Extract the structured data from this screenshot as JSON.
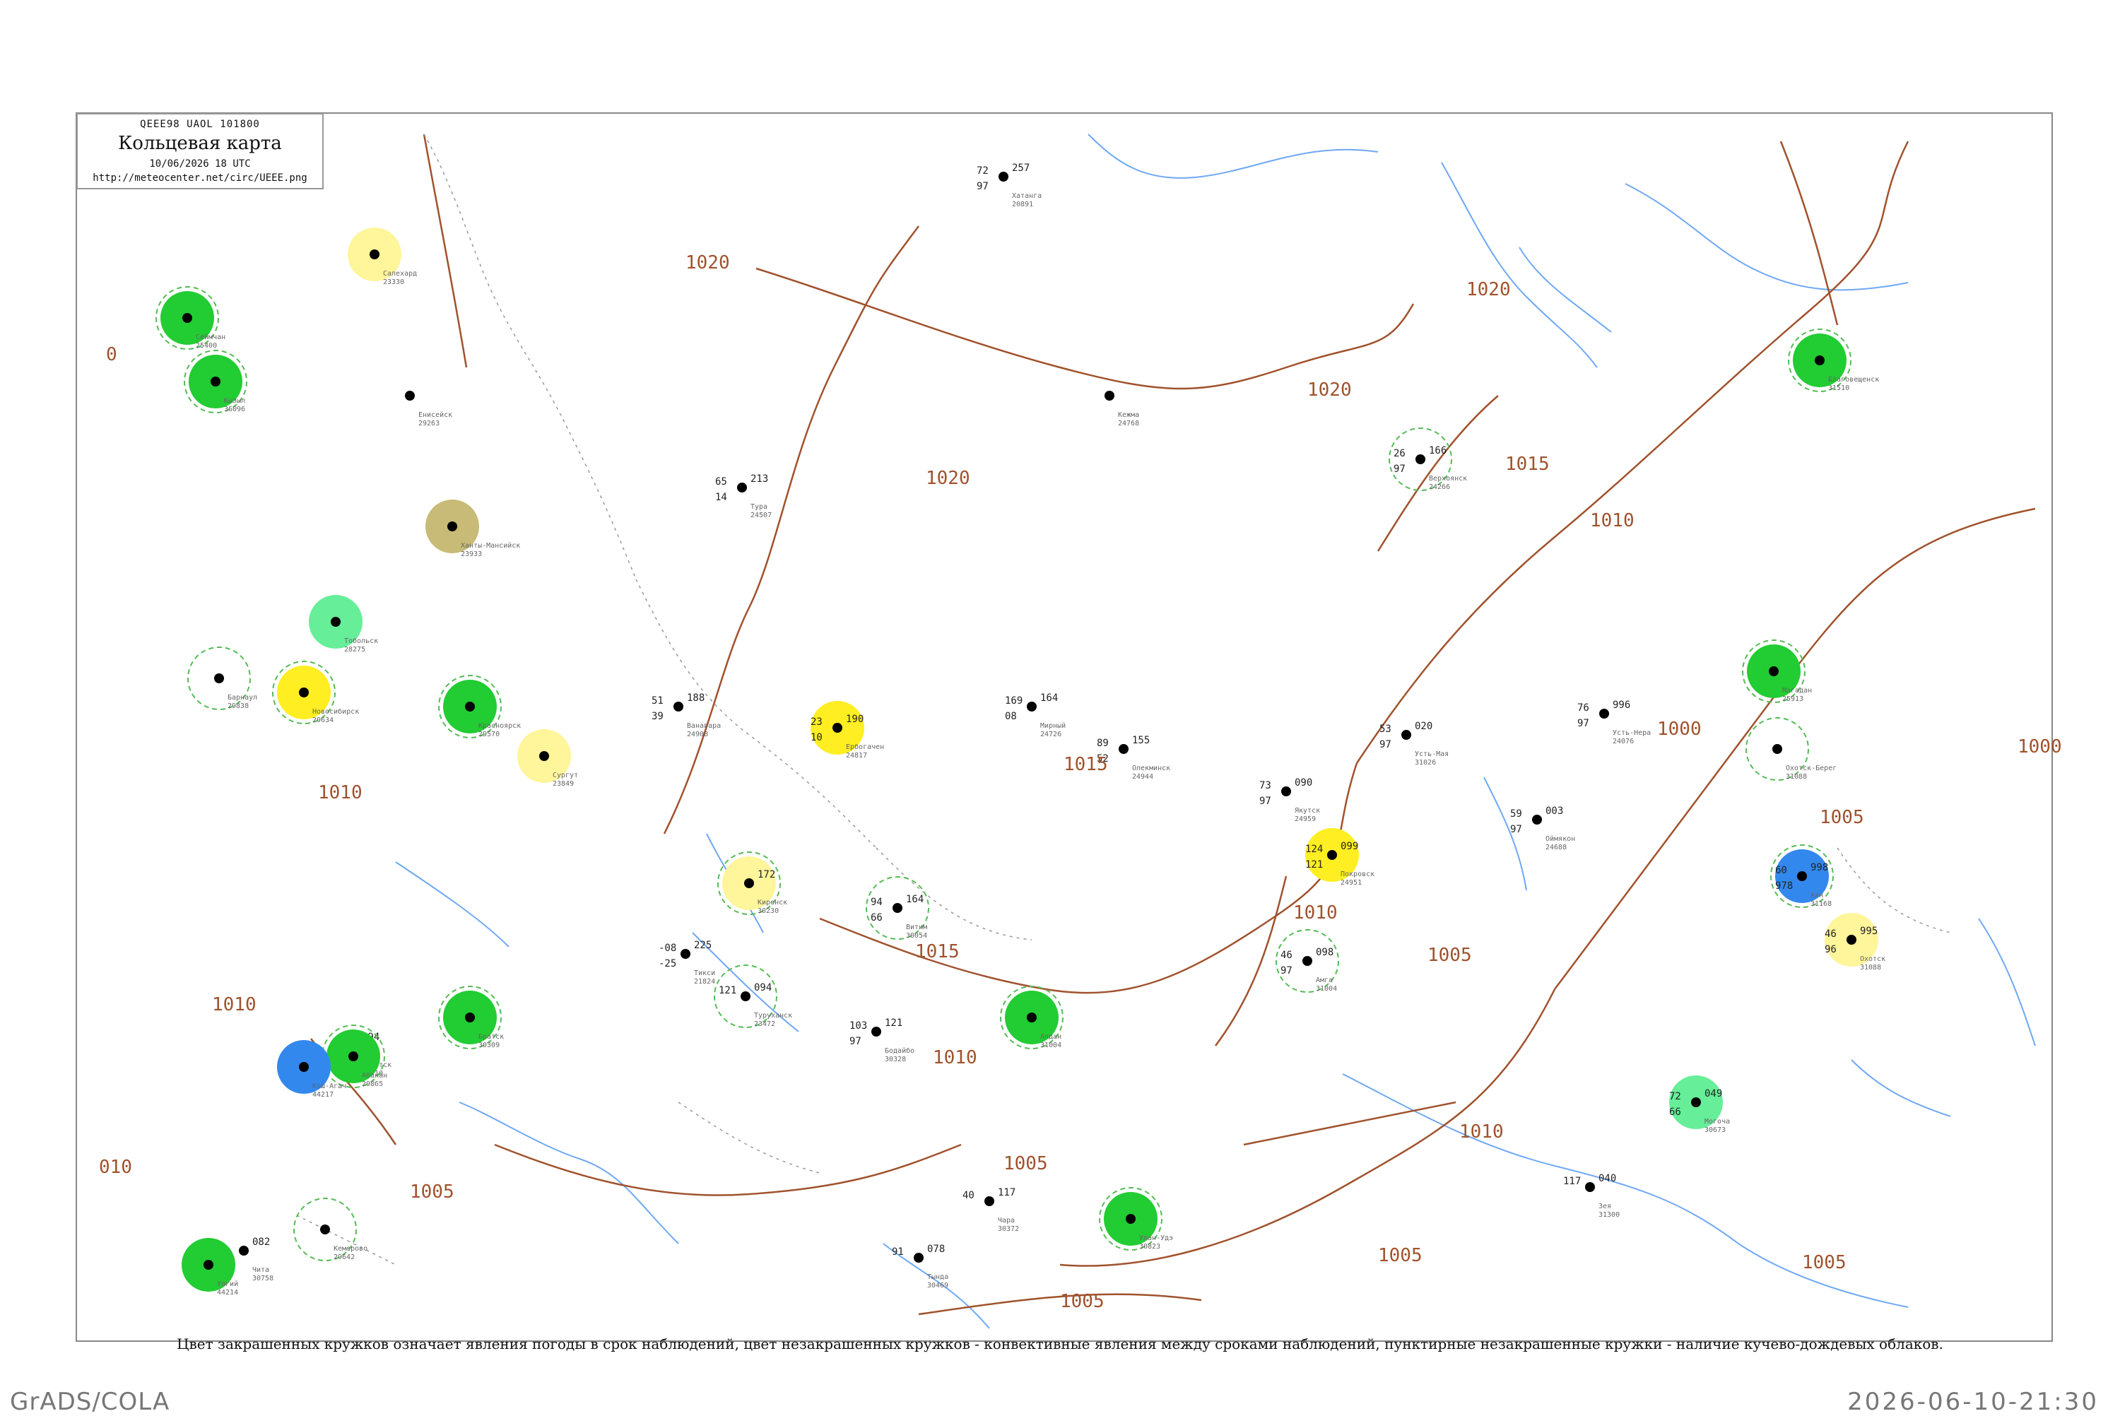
{
  "header": {
    "bulletin": "QEEE98 UAOL 101800",
    "title": "Кольцевая карта",
    "datetime": "10/06/2026 18 UTC",
    "url": "http://meteocenter.net/circ/UEEE.png"
  },
  "footnote": "Цвет закрашенных кружков означает явления погоды в срок наблюдений, цвет незакрашенных кружков - конвективные явления между сроками наблюдений, пунктирные незакрашенные кружки - наличие кучево-дождевых облаков.",
  "footer": {
    "software": "GrADS/COLA",
    "timestamp": "2026-06-10-21:30"
  },
  "colors": {
    "isobar": "#a0522d",
    "river": "#6fa8f5",
    "frame": "#888888",
    "cb_circle": "#55bb55",
    "conv_circle": "#dd6677",
    "weather_green": "#22cc33",
    "weather_yellow": "#ffee22",
    "weather_lightyellow": "#fff59a",
    "weather_olive": "#c8bb77",
    "weather_blue": "#3388ee",
    "weather_lightgreen": "#66ee99"
  },
  "isobar_labels": [
    "1020",
    "1020",
    "1020",
    "1020",
    "1015",
    "1015",
    "1015",
    "1010",
    "1010",
    "1010",
    "1010",
    "1005",
    "1005",
    "1005",
    "1005",
    "1005",
    "1005",
    "1000",
    "1000",
    "1005",
    "010",
    "0",
    "1010",
    "1010"
  ],
  "stations": [
    {
      "name": "Ванавара",
      "id": "24908",
      "p": "188",
      "t": "51",
      "td": "39",
      "marker": "none",
      "cb": false
    },
    {
      "name": "Тура",
      "id": "24507",
      "p": "213",
      "t": "65",
      "td": "14",
      "marker": "none",
      "cb": false
    },
    {
      "name": "Туруханск",
      "id": "23472",
      "p": "094",
      "t": "121",
      "td": "",
      "marker": "none",
      "cb": true
    },
    {
      "name": "Ербогачен",
      "id": "24817",
      "p": "190",
      "t": "23",
      "td": "10",
      "marker": "yellow",
      "cb": false
    },
    {
      "name": "Витим",
      "id": "30054",
      "p": "164",
      "t": "94",
      "td": "66",
      "marker": "none",
      "cb": true
    },
    {
      "name": "Киренск",
      "id": "30230",
      "p": "172",
      "t": "",
      "td": "",
      "marker": "lightyellow",
      "cb": true
    },
    {
      "name": "Мирный",
      "id": "24726",
      "p": "164",
      "t": "169",
      "td": "08",
      "marker": "none",
      "cb": false
    },
    {
      "name": "Олекминск",
      "id": "24944",
      "p": "155",
      "t": "89",
      "td": "52",
      "marker": "none",
      "cb": false
    },
    {
      "name": "Якутск",
      "id": "24959",
      "p": "090",
      "t": "73",
      "td": "97",
      "marker": "none",
      "cb": false
    },
    {
      "name": "Покровск",
      "id": "24951",
      "p": "099",
      "t": "124",
      "td": "121",
      "marker": "yellow",
      "cb": false
    },
    {
      "name": "Амга",
      "id": "31004",
      "p": "098",
      "t": "46",
      "td": "97",
      "marker": "none",
      "cb": true
    },
    {
      "name": "Алдан",
      "id": "31004",
      "p": "",
      "t": "",
      "td": "",
      "marker": "green",
      "cb": true
    },
    {
      "name": "Усть-Мая",
      "id": "31026",
      "p": "020",
      "t": "53",
      "td": "97",
      "marker": "none",
      "cb": false
    },
    {
      "name": "Оймякон",
      "id": "24688",
      "p": "003",
      "t": "59",
      "td": "97",
      "marker": "none",
      "cb": false
    },
    {
      "name": "Усть-Нера",
      "id": "24076",
      "p": "996",
      "t": "76",
      "td": "97",
      "marker": "none",
      "cb": false
    },
    {
      "name": "Охотск",
      "id": "31088",
      "p": "995",
      "t": "46",
      "td": "96",
      "marker": "lightyellow",
      "cb": false
    },
    {
      "name": "Аян",
      "id": "31168",
      "p": "998",
      "t": "60",
      "td": "978",
      "marker": "blue",
      "cb": true
    },
    {
      "name": "Зея",
      "id": "31300",
      "p": "040",
      "t": "117",
      "td": "",
      "marker": "none",
      "cb": false
    },
    {
      "name": "Тында",
      "id": "30469",
      "p": "078",
      "t": "91",
      "td": "",
      "marker": "none",
      "cb": false
    },
    {
      "name": "Чара",
      "id": "30372",
      "p": "117",
      "t": "40",
      "td": "",
      "marker": "none",
      "cb": false
    },
    {
      "name": "Бодайбо",
      "id": "30328",
      "p": "121",
      "t": "103",
      "td": "97",
      "marker": "none",
      "cb": false
    },
    {
      "name": "Чита",
      "id": "30758",
      "p": "082",
      "t": "",
      "td": "",
      "marker": "none",
      "cb": false
    },
    {
      "name": "Иркутск",
      "id": "30710",
      "p": "094",
      "t": "",
      "td": "",
      "marker": "none",
      "cb": false
    },
    {
      "name": "Братск",
      "id": "30309",
      "p": "",
      "t": "",
      "td": "",
      "marker": "green",
      "cb": true
    },
    {
      "name": "Красноярск",
      "id": "29570",
      "p": "",
      "t": "",
      "td": "",
      "marker": "green",
      "cb": true
    },
    {
      "name": "Енисейск",
      "id": "29263",
      "p": "",
      "t": "",
      "td": "",
      "marker": "none",
      "cb": false
    },
    {
      "name": "Кежма",
      "id": "24768",
      "p": "",
      "t": "",
      "td": "",
      "marker": "none",
      "cb": false
    },
    {
      "name": "Кемерово",
      "id": "29642",
      "p": "",
      "t": "",
      "td": "",
      "marker": "none",
      "cb": true
    },
    {
      "name": "Новосибирск",
      "id": "29634",
      "p": "",
      "t": "",
      "td": "",
      "marker": "yellow",
      "cb": true
    },
    {
      "name": "Барнаул",
      "id": "29838",
      "p": "",
      "t": "",
      "td": "",
      "marker": "none",
      "cb": true
    },
    {
      "name": "Кызыл",
      "id": "36096",
      "p": "",
      "t": "",
      "td": "",
      "marker": "green",
      "cb": true
    },
    {
      "name": "Тикси",
      "id": "21824",
      "p": "225",
      "t": "-08",
      "td": "-25",
      "marker": "none",
      "cb": false
    },
    {
      "name": "Верхоянск",
      "id": "24266",
      "p": "166",
      "t": "26",
      "td": "97",
      "marker": "none",
      "cb": true
    },
    {
      "name": "Хатанга",
      "id": "20891",
      "p": "257",
      "t": "72",
      "td": "97",
      "marker": "none",
      "cb": false
    },
    {
      "name": "Сургут",
      "id": "23849",
      "p": "",
      "t": "",
      "td": "",
      "marker": "lightyellow",
      "cb": false
    },
    {
      "name": "Салехард",
      "id": "23330",
      "p": "",
      "t": "",
      "td": "",
      "marker": "lightyellow",
      "cb": false
    },
    {
      "name": "Ханты-Мансийск",
      "id": "23933",
      "p": "",
      "t": "",
      "td": "",
      "marker": "olive",
      "cb": false
    },
    {
      "name": "Тобольск",
      "id": "28275",
      "p": "",
      "t": "",
      "td": "",
      "marker": "lightgreen",
      "cb": false
    },
    {
      "name": "Сеймчан",
      "id": "25400",
      "p": "",
      "t": "",
      "td": "",
      "marker": "green",
      "cb": true
    },
    {
      "name": "Магадан",
      "id": "25913",
      "p": "",
      "t": "",
      "td": "",
      "marker": "green",
      "cb": true
    },
    {
      "name": "Охотск-Берег",
      "id": "31088",
      "p": "",
      "t": "",
      "td": "",
      "marker": "none",
      "cb": true
    },
    {
      "name": "Благовещенск",
      "id": "31510",
      "p": "",
      "t": "",
      "td": "",
      "marker": "green",
      "cb": true
    },
    {
      "name": "Могоча",
      "id": "30673",
      "p": "049",
      "t": "72",
      "td": "66",
      "marker": "lightgreen",
      "cb": false
    },
    {
      "name": "Улан-Удэ",
      "id": "30823",
      "p": "",
      "t": "",
      "td": "",
      "marker": "green",
      "cb": true
    },
    {
      "name": "Абакан",
      "id": "29865",
      "p": "",
      "t": "",
      "td": "",
      "marker": "green",
      "cb": true
    },
    {
      "name": "Кош-Агач",
      "id": "44217",
      "p": "",
      "t": "",
      "td": "",
      "marker": "blue",
      "cb": false
    },
    {
      "name": "Улгий",
      "id": "44214",
      "p": "",
      "t": "",
      "td": "",
      "marker": "green",
      "cb": false
    }
  ]
}
